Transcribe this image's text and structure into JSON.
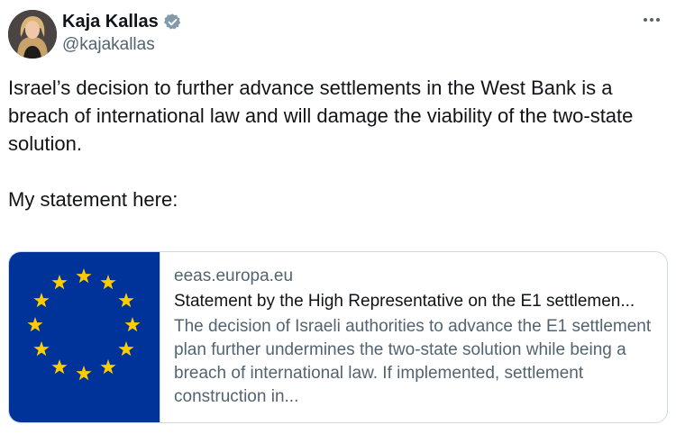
{
  "author": {
    "name": "Kaja Kallas",
    "handle": "@kajakallas",
    "avatar_icon": "profile-photo",
    "verified_icon": "verified-badge-icon",
    "verified_color": "#829aab"
  },
  "tweet": {
    "text_line1": "Israel’s decision to further advance settlements in the West Bank is a breach of international law and will damage the viability of the two-state solution.",
    "text_line2": "My statement here:"
  },
  "card": {
    "domain": "eeas.europa.eu",
    "title": "Statement by the High Representative on the E1 settlemen...",
    "description": "The decision of Israeli authorities to advance the E1 settlement plan further undermines the two-state solution while being a breach of international law. If implemented, settlement construction in...",
    "image_icon": "eu-flag",
    "flag_blue": "#003399",
    "flag_gold": "#ffcc00"
  },
  "menu": {
    "icon": "more-options-icon"
  }
}
